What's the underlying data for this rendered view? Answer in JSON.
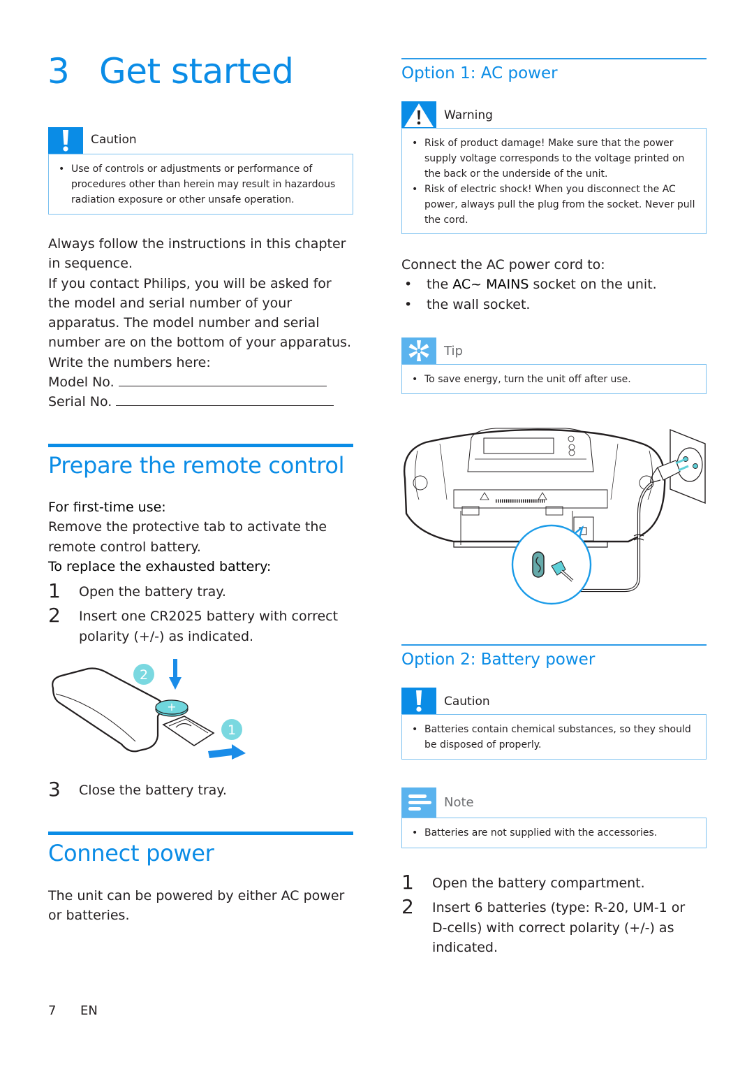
{
  "chapter": {
    "number": "3",
    "title": "Get started"
  },
  "left": {
    "caution_box": {
      "label": "Caution",
      "icon": "exclamation-icon",
      "items": [
        "Use of controls or adjustments or performance of procedures other than herein may result in hazardous radiation exposure or other unsafe operation."
      ]
    },
    "intro": {
      "p1": "Always follow the instructions in this chapter in sequence.",
      "p2": "If you contact Philips, you will be asked for the model and serial number of your apparatus. The model number and serial number are on the bottom of your apparatus. Write the numbers here:",
      "model_label": "Model No.",
      "serial_label": "Serial No."
    },
    "remote": {
      "heading": "Prepare the remote control",
      "first_time_label": "For first-time use:",
      "first_time_text": "Remove the protective tab to activate the remote control battery.",
      "replace_label": "To replace the exhausted battery:",
      "steps": [
        {
          "n": "1",
          "text": "Open the battery tray."
        },
        {
          "n": "2",
          "text": "Insert one CR2025 battery with correct polarity (+/-) as indicated."
        },
        {
          "n": "3",
          "text": "Close the battery tray."
        }
      ],
      "illustration": {
        "callout_1": "1",
        "callout_2": "2",
        "battery_mark": "+"
      }
    },
    "connect": {
      "heading": "Connect power",
      "text": "The unit can be powered by either AC power or batteries."
    }
  },
  "right": {
    "option1": {
      "heading": "Option 1: AC power",
      "warning_box": {
        "label": "Warning",
        "icon": "warning-triangle-icon",
        "items": [
          "Risk of product damage! Make sure that the power supply voltage corresponds to the voltage printed on the back or the underside of the unit.",
          "Risk of electric shock! When you disconnect the AC power, always pull the plug from the socket. Never pull the cord."
        ]
      },
      "connect_intro": "Connect the AC power cord to:",
      "bullets": [
        {
          "pre": "the ",
          "bold": "AC~ MAINS",
          "post": " socket on the unit."
        },
        {
          "pre": "the wall socket.",
          "bold": "",
          "post": ""
        }
      ],
      "tip_box": {
        "label": "Tip",
        "icon": "asterisk-tip-icon",
        "items": [
          "To save energy, turn the unit off after use."
        ]
      }
    },
    "option2": {
      "heading": "Option 2: Battery power",
      "caution_box": {
        "label": "Caution",
        "icon": "exclamation-icon",
        "items": [
          "Batteries contain chemical substances, so they should be disposed of properly."
        ]
      },
      "note_box": {
        "label": "Note",
        "icon": "note-lines-icon",
        "items": [
          "Batteries are not supplied with the accessories."
        ]
      },
      "steps": [
        {
          "n": "1",
          "text": "Open the battery compartment."
        },
        {
          "n": "2",
          "text": "Insert 6 batteries (type: R-20, UM-1 or D-cells) with correct polarity (+/-) as indicated."
        }
      ]
    }
  },
  "footer": {
    "page": "7",
    "lang": "EN"
  },
  "colors": {
    "accent": "#0a8ce6",
    "box_border": "#7cc1f0",
    "tip_icon": "#5ab3ee",
    "text": "#231f20"
  }
}
